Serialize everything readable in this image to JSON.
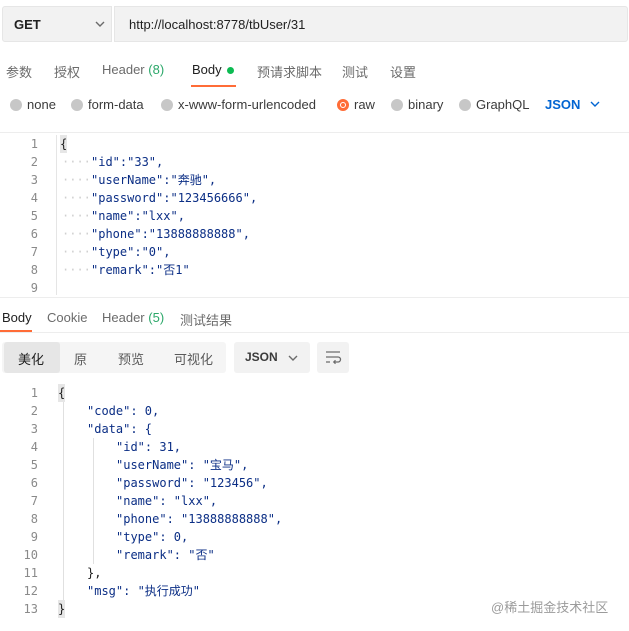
{
  "request": {
    "method": "GET",
    "url": "http://localhost:8778/tbUser/31"
  },
  "tabs": [
    {
      "label": "参数"
    },
    {
      "label": "授权"
    },
    {
      "label": "Header",
      "count": "(8)"
    },
    {
      "label": "Body"
    },
    {
      "label": "预请求脚本"
    },
    {
      "label": "测试"
    },
    {
      "label": "设置"
    }
  ],
  "body_types": {
    "options": [
      "none",
      "form-data",
      "x-www-form-urlencoded",
      "raw",
      "binary",
      "GraphQL"
    ],
    "selected": "raw",
    "format": "JSON"
  },
  "request_body": {
    "line_numbers": [
      "1",
      "2",
      "3",
      "4",
      "5",
      "6",
      "7",
      "8",
      "9"
    ],
    "lines": [
      "{",
      "\"id\":\"33\",",
      "\"userName\":\"奔驰\",",
      "\"password\":\"123456666\",",
      "\"name\":\"lxx\",",
      "\"phone\":\"13888888888\",",
      "\"type\":\"0\",",
      "\"remark\":\"否1\"",
      ""
    ]
  },
  "response_tabs": [
    {
      "label": "Body"
    },
    {
      "label": "Cookie"
    },
    {
      "label": "Header",
      "count": "(5)"
    },
    {
      "label": "测试结果"
    }
  ],
  "response_toolbar": {
    "views": [
      "美化",
      "原",
      "预览",
      "可视化"
    ],
    "format": "JSON"
  },
  "response_body": {
    "line_numbers": [
      "1",
      "2",
      "3",
      "4",
      "5",
      "6",
      "7",
      "8",
      "9",
      "10",
      "11",
      "12",
      "13"
    ],
    "lines": [
      "{",
      "\"code\": 0,",
      "\"data\": {",
      "\"id\": 31,",
      "\"userName\": \"宝马\",",
      "\"password\": \"123456\",",
      "\"name\": \"lxx\",",
      "\"phone\": \"13888888888\",",
      "\"type\": 0,",
      "\"remark\": \"否\"",
      "},",
      "\"msg\": \"执行成功\"",
      "}"
    ]
  },
  "watermark": "@稀土掘金技术社区",
  "colors": {
    "accent": "#ff6c37",
    "link_blue": "#0265d2",
    "success_green": "#0cbb52"
  }
}
